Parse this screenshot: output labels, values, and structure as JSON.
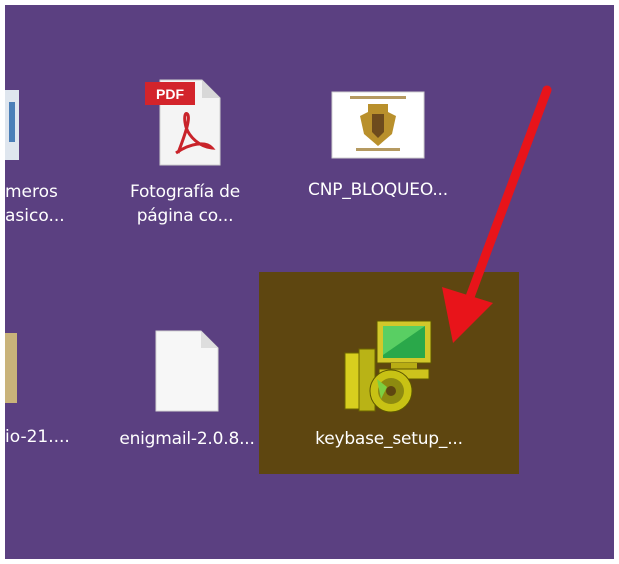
{
  "desktop": {
    "background_color": "#5b4081",
    "selection_color": "#5e4610",
    "annotation_arrow_color": "#e8141a",
    "icons": [
      {
        "name": "partial-folder-top",
        "label_lines": [
          "meros",
          "asico..."
        ]
      },
      {
        "name": "pdf-file",
        "badge": "PDF",
        "label_lines": [
          "Fotografía de",
          "página co..."
        ]
      },
      {
        "name": "image-file",
        "label_lines": [
          "CNP_BLOQUEO..."
        ]
      },
      {
        "name": "partial-folder-bottom",
        "label_lines": [
          "io-21...."
        ]
      },
      {
        "name": "blank-file",
        "label_lines": [
          "enigmail-2.0.8..."
        ]
      },
      {
        "name": "installer-file",
        "label_lines": [
          "keybase_setup_..."
        ],
        "selected": true
      }
    ]
  }
}
